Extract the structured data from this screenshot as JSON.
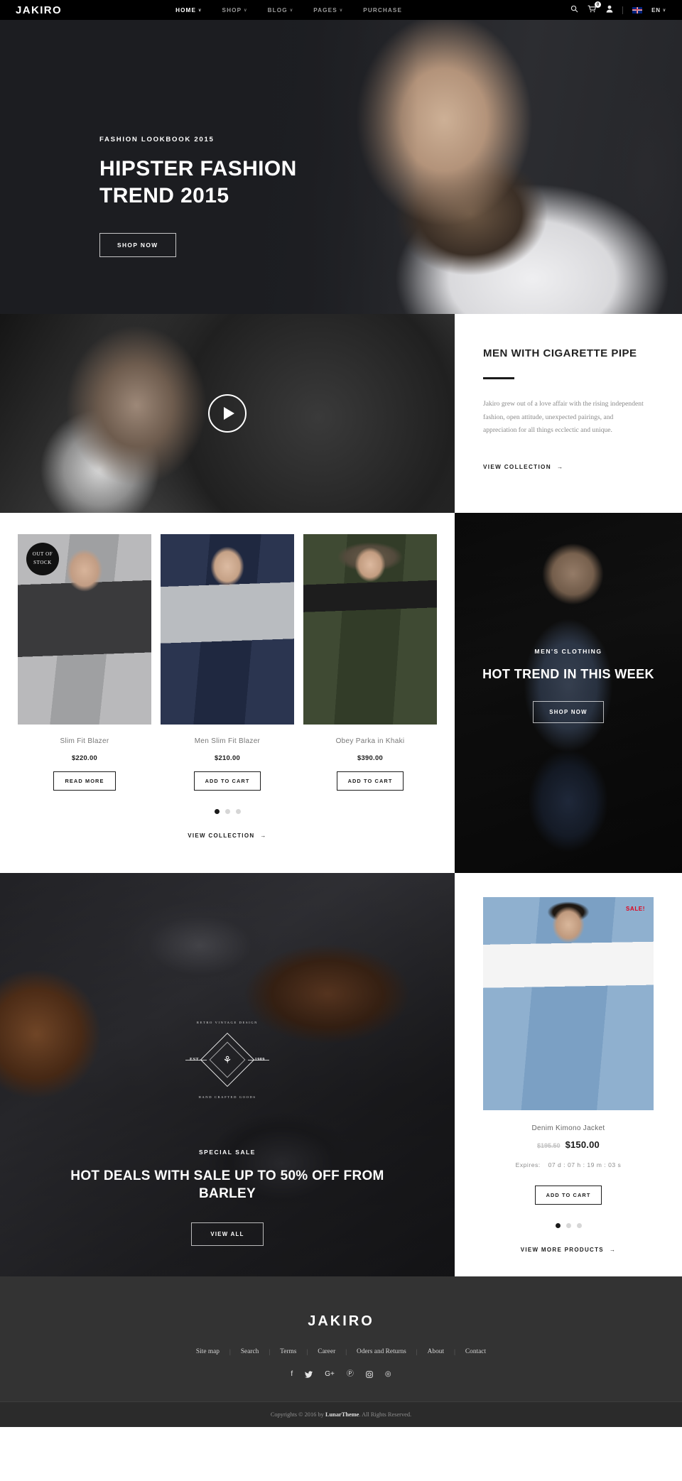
{
  "header": {
    "logo": "JAKIRO",
    "nav": [
      {
        "label": "HOME",
        "caret": "∨",
        "active": true
      },
      {
        "label": "SHOP",
        "caret": "∨",
        "active": false
      },
      {
        "label": "BLOG",
        "caret": "∨",
        "active": false
      },
      {
        "label": "PAGES",
        "caret": "∨",
        "active": false
      },
      {
        "label": "PURCHASE",
        "caret": "",
        "active": false
      }
    ],
    "search_icon": "⌕",
    "cart_icon": "🛒",
    "cart_count": "0",
    "account_icon": "👤",
    "language": "EN",
    "language_caret": "∨"
  },
  "hero": {
    "kicker": "FASHION LOOKBOOK 2015",
    "title": "HIPSTER FASHION TREND 2015",
    "button": "SHOP NOW"
  },
  "about": {
    "title": "MEN WITH CIGARETTE PIPE",
    "paragraph": "Jakiro grew out of a love affair with the rising independent fashion, open attitude, unexpected pairings, and appreciation for all things ecclectic and unique.",
    "link": "VIEW COLLECTION",
    "arrow": "→"
  },
  "products": {
    "items": [
      {
        "name": "Slim Fit Blazer",
        "price": "$220.00",
        "button": "READ MORE",
        "badge": [
          "OUT OF",
          "STOCK"
        ]
      },
      {
        "name": "Men Slim Fit Blazer",
        "price": "$210.00",
        "button": "ADD TO CART",
        "badge": null
      },
      {
        "name": "Obey Parka in Khaki",
        "price": "$390.00",
        "button": "ADD TO CART",
        "badge": null
      }
    ],
    "dots": [
      true,
      false,
      false
    ],
    "link": "VIEW COLLECTION",
    "arrow": "→"
  },
  "promo": {
    "kicker": "MEN'S CLOTHING",
    "title": "HOT TREND IN THIS WEEK",
    "button": "SHOP NOW"
  },
  "sale": {
    "kicker": "SPECIAL SALE",
    "title": "HOT DEALS WITH SALE UP TO 50% OFF FROM BARLEY",
    "button": "VIEW ALL",
    "emblem": {
      "top": "RETRO VINTAGE DESIGN",
      "bottom": "HAND CRAFTED GOODS",
      "left": "EST.",
      "right": "1989",
      "center": "⚘"
    }
  },
  "deal": {
    "badge": "SALE!",
    "name": "Denim Kimono Jacket",
    "price_old": "$195.50",
    "price_new": "$150.00",
    "expires_label": "Expires:",
    "expires_value": "07 d : 07 h : 19 m : 03 s",
    "button": "ADD TO CART",
    "dots": [
      true,
      false,
      false
    ],
    "link": "VIEW MORE PRODUCTS",
    "arrow": "→"
  },
  "footer": {
    "logo": "JAKIRO",
    "links": [
      "Site map",
      "Search",
      "Terms",
      "Career",
      "Oders and Returns",
      "About",
      "Contact"
    ],
    "divider": "|",
    "socials": [
      {
        "name": "facebook-icon",
        "glyph": "f"
      },
      {
        "name": "twitter-icon",
        "glyph": "𝕏"
      },
      {
        "name": "google-plus-icon",
        "glyph": "G+"
      },
      {
        "name": "pinterest-icon",
        "glyph": "Ⓟ"
      },
      {
        "name": "instagram-icon",
        "glyph": "▣"
      },
      {
        "name": "dribbble-icon",
        "glyph": "◎"
      }
    ],
    "copyright_pre": "Copyrights © 2016 by ",
    "copyright_brand": "LunarTheme",
    "copyright_post": ". All Rights Reserved."
  },
  "colors": {
    "header_bg": "#000000",
    "hero_bg": "#1c1d21",
    "footer_bg": "#333333",
    "copy_bg": "#2b2b2b",
    "accent_sale": "#e2001a",
    "text_dark": "#1b1b1b"
  }
}
